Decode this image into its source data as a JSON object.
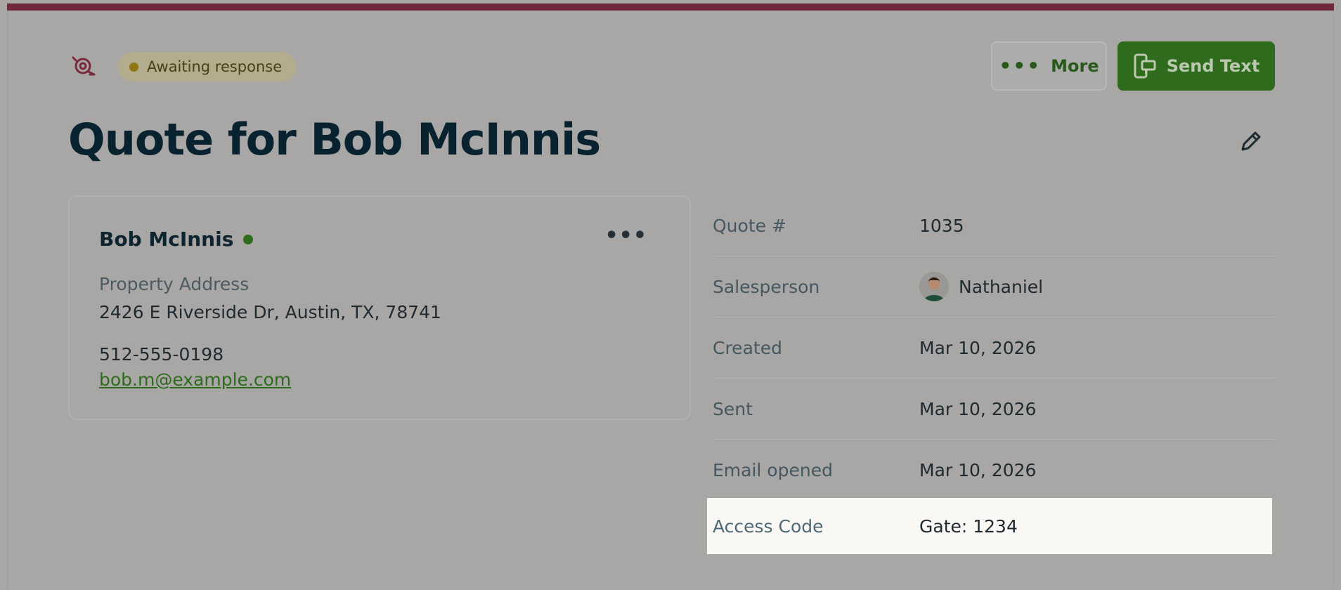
{
  "header": {
    "status_label": "Awaiting response",
    "more_label": "More",
    "send_label": "Send Text"
  },
  "page": {
    "title": "Quote for Bob McInnis"
  },
  "client": {
    "name": "Bob McInnis",
    "address_label": "Property Address",
    "address": "2426 E Riverside Dr, Austin, TX, 78741",
    "phone": "512-555-0198",
    "email": "bob.m@example.com"
  },
  "details": {
    "rows": [
      {
        "label": "Quote #",
        "value": "1035"
      },
      {
        "label": "Salesperson",
        "value": "Nathaniel"
      },
      {
        "label": "Created",
        "value": "Mar 10, 2026"
      },
      {
        "label": "Sent",
        "value": "Mar 10, 2026"
      },
      {
        "label": "Email opened",
        "value": "Mar 10, 2026"
      }
    ],
    "highlighted": {
      "label": "Access Code",
      "value": "Gate: 1234"
    }
  },
  "colors": {
    "brand_top_bar": "#6e2a3b",
    "primary_button": "#2e6b1d",
    "status_pill": "#b3ad8d",
    "online_indicator": "#2f6d1e"
  },
  "icons": {
    "quote": "quote-icon",
    "more": "ellipsis-icon",
    "send": "send-text-icon",
    "edit": "pencil-icon",
    "card_menu": "ellipsis-icon"
  }
}
